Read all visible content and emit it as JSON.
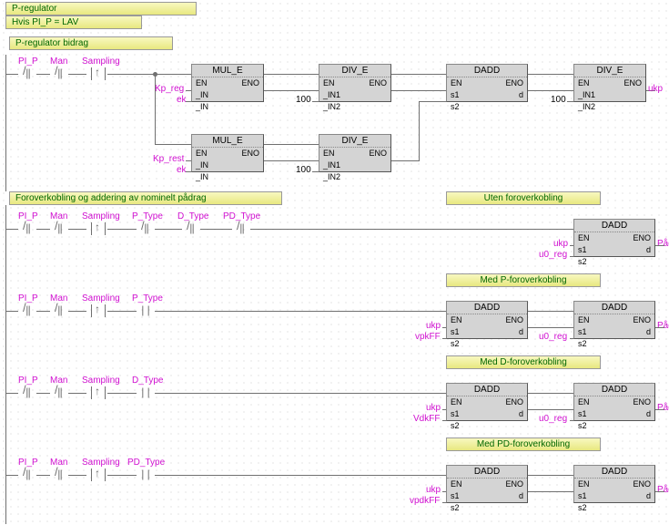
{
  "headers": {
    "tab1": "P-regulator",
    "tab2": "Hvis PI_P = LAV",
    "sec1": "P-regulator bidrag",
    "sec2": "Foroverkobling og addering av nominelt pådrag",
    "sec3": "Uten foroverkobling",
    "sec4": "Med P-foroverkobling",
    "sec5": "Med D-foroverkobling",
    "sec6": "Med PD-foroverkobling"
  },
  "signals": {
    "PI_P": "PI_P",
    "Man": "Man",
    "Sampling": "Sampling",
    "Kp_reg": "Kp_reg",
    "Kp_rest": "Kp_rest",
    "ek": "ek",
    "ukp": "ukp",
    "u0_reg": "u0_reg",
    "Padrag": "Pådrag",
    "P_Type": "P_Type",
    "D_Type": "D_Type",
    "PD_Type": "PD_Type",
    "vpkFF": "vpkFF",
    "VdkFF": "VdkFF",
    "vpdkFF": "vpdkFF"
  },
  "consts": {
    "c100": "100"
  },
  "blocks": {
    "MUL_E": {
      "title": "MUL_E",
      "l1": "EN",
      "r1": "ENO",
      "l2": "_IN",
      "l3": "_IN"
    },
    "DIV_E": {
      "title": "DIV_E",
      "l1": "EN",
      "r1": "ENO",
      "l2": "_IN1",
      "l3": "_IN2"
    },
    "DADD": {
      "title": "DADD",
      "l1": "EN",
      "r1": "ENO",
      "l2": "s1",
      "r2": "d",
      "l3": "s2"
    }
  }
}
